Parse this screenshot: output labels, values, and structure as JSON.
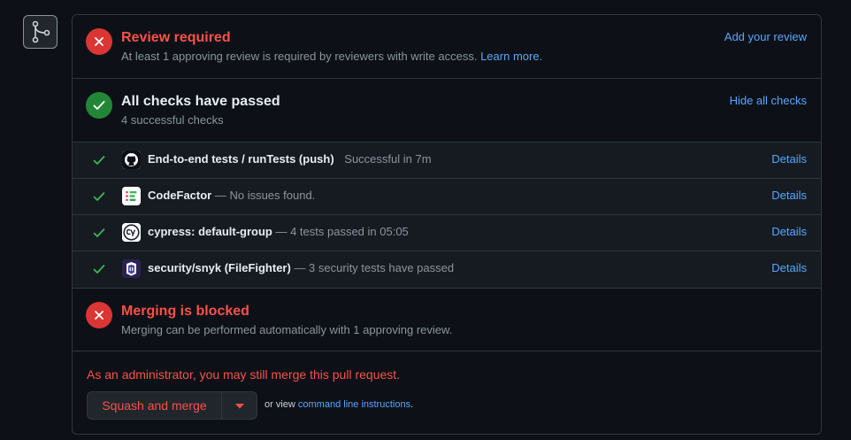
{
  "colors": {
    "danger": "#f85149",
    "success": "#3fb950",
    "link": "#58a6ff",
    "muted": "#8b949e",
    "background": "#0d1117",
    "border": "#30363d"
  },
  "timeline_icon": "git-merge-icon",
  "review": {
    "title": "Review required",
    "subtitle": "At least 1 approving review is required by reviewers with write access.",
    "learn_more": "Learn more",
    "period": ".",
    "action": "Add your review"
  },
  "checks": {
    "title": "All checks have passed",
    "subtitle": "4 successful checks",
    "toggle": "Hide all checks",
    "items": [
      {
        "icon": "github-icon",
        "name": "End-to-end tests / runTests (push)",
        "description": "Successful in 7m",
        "details": "Details"
      },
      {
        "icon": "codefactor-icon",
        "name": "CodeFactor",
        "description": " — No issues found.",
        "details": "Details"
      },
      {
        "icon": "cypress-icon",
        "name": "cypress: default-group",
        "description": " — 4 tests passed in 05:05",
        "details": "Details"
      },
      {
        "icon": "snyk-icon",
        "name": "security/snyk (FileFighter)",
        "description": " — 3 security tests have passed",
        "details": "Details"
      }
    ]
  },
  "blocked": {
    "title": "Merging is blocked",
    "subtitle": "Merging can be performed automatically with 1 approving review."
  },
  "admin": {
    "notice": "As an administrator, you may still merge this pull request.",
    "merge_button": "Squash and merge",
    "or_view": "or view ",
    "cli_link": "command line instructions",
    "period": "."
  }
}
